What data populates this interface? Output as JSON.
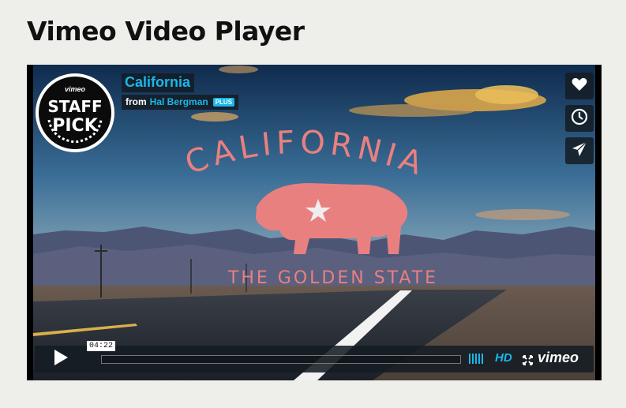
{
  "page": {
    "title": "Vimeo Video Player"
  },
  "video": {
    "title": "California",
    "byline_prefix": "from",
    "author": "Hal Bergman",
    "author_badge": "PLUS",
    "overlay_headline": "CALIFORNIA",
    "overlay_subtitle": "THE GOLDEN STATE"
  },
  "badge": {
    "brand": "vimeo",
    "line1": "STAFF",
    "line2": "PICK"
  },
  "side_actions": [
    {
      "icon": "heart-icon"
    },
    {
      "icon": "clock-icon"
    },
    {
      "icon": "paper-plane-icon"
    }
  ],
  "controls": {
    "play_icon": "play-icon",
    "timecode": "04:22",
    "progress": 0,
    "hd_label": "HD",
    "logo": "vimeo"
  },
  "colors": {
    "accent": "#1ab7ea",
    "overlay_text": "#e98080"
  }
}
